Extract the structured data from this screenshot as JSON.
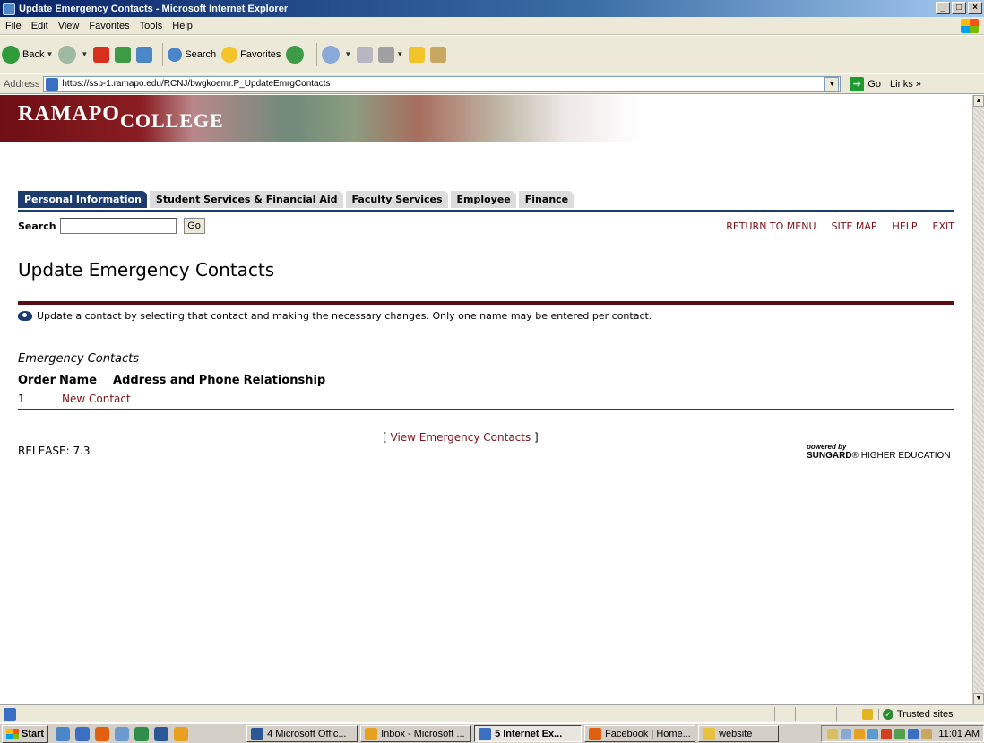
{
  "window": {
    "title": "Update Emergency Contacts - Microsoft Internet Explorer"
  },
  "menu": [
    "File",
    "Edit",
    "View",
    "Favorites",
    "Tools",
    "Help"
  ],
  "toolbar": {
    "back": "Back",
    "search": "Search",
    "favorites": "Favorites"
  },
  "address": {
    "label": "Address",
    "url": "https://ssb-1.ramapo.edu/RCNJ/bwgkoemr.P_UpdateEmrgContacts",
    "go": "Go",
    "links": "Links"
  },
  "page": {
    "logo_main": "RAMAPO",
    "logo_sub": "COLLEGE",
    "tabs": [
      "Personal Information",
      "Student Services & Financial Aid",
      "Faculty Services",
      "Employee",
      "Finance"
    ],
    "search_label": "Search",
    "search_go": "Go",
    "nav": [
      "RETURN TO MENU",
      "SITE MAP",
      "HELP",
      "EXIT"
    ],
    "title": "Update Emergency Contacts",
    "info": "Update a contact by selecting that contact and making the necessary changes. Only one name may be entered per contact.",
    "section_title": "Emergency Contacts",
    "columns": [
      "Order",
      "Name",
      "Address and Phone",
      "Relationship"
    ],
    "rows": [
      {
        "order": "1",
        "name": "New Contact"
      }
    ],
    "view_link_open": "[ ",
    "view_link": "View Emergency Contacts",
    "view_link_close": " ]",
    "release": "RELEASE: 7.3",
    "powered_by": "powered by",
    "sungard": "SUNGARD",
    "higher_ed": "HIGHER EDUCATION"
  },
  "status": {
    "zone": "Trusted sites"
  },
  "taskbar": {
    "start": "Start",
    "tasks": [
      {
        "label": "4 Microsoft Offic...",
        "color": "#2b5797"
      },
      {
        "label": "Inbox - Microsoft ...",
        "color": "#e8a020"
      },
      {
        "label": "5 Internet Ex...",
        "color": "#3b6fc3"
      },
      {
        "label": "Facebook | Home...",
        "color": "#e06010"
      },
      {
        "label": "website",
        "color": "#e8c040"
      }
    ],
    "clock": "11:01 AM"
  }
}
